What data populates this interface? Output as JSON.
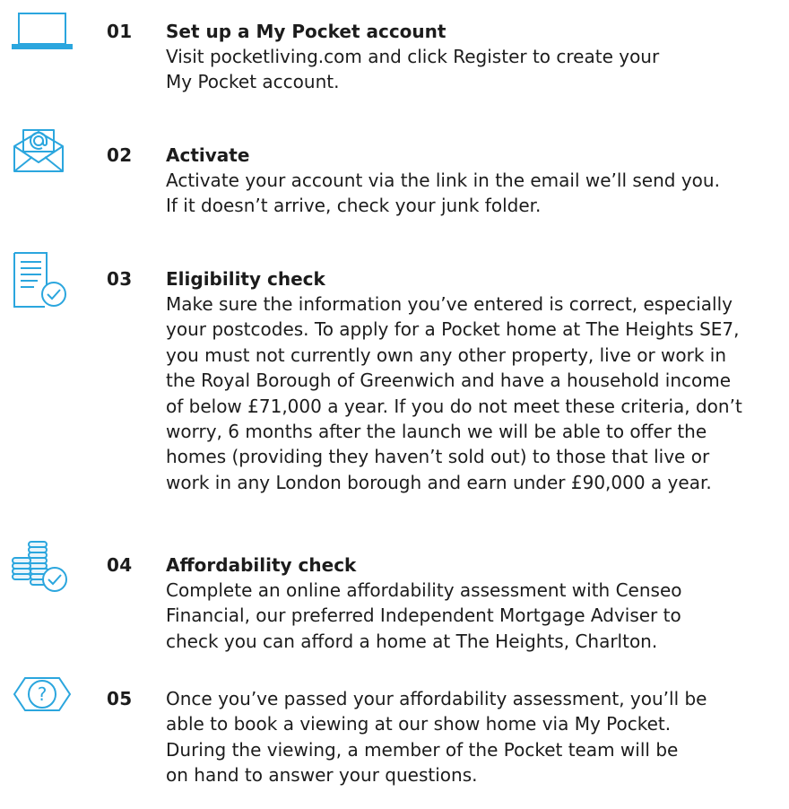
{
  "icon_color": "#2ba6de",
  "steps": [
    {
      "number": "01",
      "title": "Set up a My Pocket account",
      "body": "Visit pocketliving.com and click Register to create your\nMy Pocket account.",
      "icon": "laptop-icon"
    },
    {
      "number": "02",
      "title": "Activate",
      "body": "Activate your account via the link in the email we’ll send you.\nIf it doesn’t arrive, check your junk folder.",
      "icon": "email-icon"
    },
    {
      "number": "03",
      "title": "Eligibility check",
      "body": "Make sure the information you’ve entered is correct, especially\nyour postcodes. To apply for a Pocket home at The Heights SE7,\nyou must not currently own any other property, live or work in\nthe Royal Borough of Greenwich and have a household income\nof below £71,000 a year. If you do not meet these criteria, don’t\nworry, 6 months after the launch we will be able to offer the\nhomes (providing they haven’t sold out) to those that live or\nwork in any London borough and earn under £90,000 a year.",
      "icon": "document-check-icon"
    },
    {
      "number": "04",
      "title": "Affordability check",
      "body": "Complete an online affordability assessment with Censeo\nFinancial, our preferred Independent Mortgage Adviser to\ncheck you can afford a home at The Heights, Charlton.",
      "icon": "coins-check-icon"
    },
    {
      "number": "05",
      "title": "",
      "body": "Once you’ve passed your affordability assessment, you’ll be\nable to book a viewing at our show home via My Pocket.\nDuring the viewing, a member of the Pocket team will be\non hand to answer your questions.",
      "icon": "eye-question-icon"
    }
  ]
}
